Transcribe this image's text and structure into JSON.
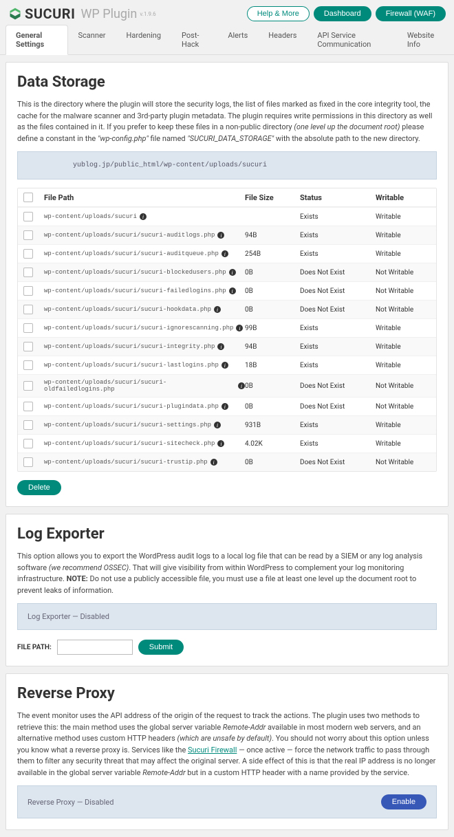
{
  "brand": {
    "text": "SUCURI",
    "plugin": "WP Plugin",
    "version": "v.1.9.6"
  },
  "topButtons": {
    "help": "Help & More",
    "dashboard": "Dashboard",
    "firewall": "Firewall (WAF)"
  },
  "tabs": [
    "General Settings",
    "Scanner",
    "Hardening",
    "Post-Hack",
    "Alerts",
    "Headers",
    "API Service Communication",
    "Website Info"
  ],
  "activeTab": 0,
  "dataStorage": {
    "title": "Data Storage",
    "desc_a": "This is the directory where the plugin will store the security logs, the list of files marked as fixed in the core integrity tool, the cache for the malware scanner and 3rd-party plugin metadata. The plugin requires write permissions in this directory as well as the files contained in it. If you prefer to keep these files in a non-public directory ",
    "desc_b": "(one level up the document root)",
    "desc_c": " please define a constant in the ",
    "desc_d": "\"wp-config.php\"",
    "desc_e": " file named ",
    "desc_f": "\"SUCURI_DATA_STORAGE\"",
    "desc_g": " with the absolute path to the new directory.",
    "path": "yublog.jp/public_html/wp-content/uploads/sucuri",
    "headers": {
      "file": "File Path",
      "size": "File Size",
      "status": "Status",
      "writable": "Writable"
    },
    "rows": [
      {
        "file": "wp-content/uploads/sucuri",
        "size": "",
        "status": "Exists",
        "writable": "Writable"
      },
      {
        "file": "wp-content/uploads/sucuri/sucuri-auditlogs.php",
        "size": "94B",
        "status": "Exists",
        "writable": "Writable"
      },
      {
        "file": "wp-content/uploads/sucuri/sucuri-auditqueue.php",
        "size": "254B",
        "status": "Exists",
        "writable": "Writable"
      },
      {
        "file": "wp-content/uploads/sucuri/sucuri-blockedusers.php",
        "size": "0B",
        "status": "Does Not Exist",
        "writable": "Not Writable"
      },
      {
        "file": "wp-content/uploads/sucuri/sucuri-failedlogins.php",
        "size": "0B",
        "status": "Does Not Exist",
        "writable": "Not Writable"
      },
      {
        "file": "wp-content/uploads/sucuri/sucuri-hookdata.php",
        "size": "0B",
        "status": "Does Not Exist",
        "writable": "Not Writable"
      },
      {
        "file": "wp-content/uploads/sucuri/sucuri-ignorescanning.php",
        "size": "99B",
        "status": "Exists",
        "writable": "Writable"
      },
      {
        "file": "wp-content/uploads/sucuri/sucuri-integrity.php",
        "size": "94B",
        "status": "Exists",
        "writable": "Writable"
      },
      {
        "file": "wp-content/uploads/sucuri/sucuri-lastlogins.php",
        "size": "18B",
        "status": "Exists",
        "writable": "Writable"
      },
      {
        "file": "wp-content/uploads/sucuri/sucuri-oldfailedlogins.php",
        "size": "0B",
        "status": "Does Not Exist",
        "writable": "Not Writable"
      },
      {
        "file": "wp-content/uploads/sucuri/sucuri-plugindata.php",
        "size": "0B",
        "status": "Does Not Exist",
        "writable": "Not Writable"
      },
      {
        "file": "wp-content/uploads/sucuri/sucuri-settings.php",
        "size": "931B",
        "status": "Exists",
        "writable": "Writable"
      },
      {
        "file": "wp-content/uploads/sucuri/sucuri-sitecheck.php",
        "size": "4.02K",
        "status": "Exists",
        "writable": "Writable"
      },
      {
        "file": "wp-content/uploads/sucuri/sucuri-trustip.php",
        "size": "0B",
        "status": "Does Not Exist",
        "writable": "Not Writable"
      }
    ],
    "deleteBtn": "Delete"
  },
  "logExporter": {
    "title": "Log Exporter",
    "desc_a": "This option allows you to export the WordPress audit logs to a local log file that can be read by a SIEM or any log analysis software ",
    "desc_b": "(we recommend OSSEC)",
    "desc_c": ". That will give visibility from within WordPress to complement your log monitoring infrastructure. ",
    "desc_d": "NOTE:",
    "desc_e": " Do not use a publicly accessible file, you must use a file at least one level up the document root to prevent leaks of information.",
    "status": "Log Exporter — Disabled",
    "label": "FILE PATH:",
    "submit": "Submit"
  },
  "reverseProxy": {
    "title": "Reverse Proxy",
    "desc_a": "The event monitor uses the API address of the origin of the request to track the actions. The plugin uses two methods to retrieve this: the main method uses the global server variable ",
    "desc_b": "Remote-Addr",
    "desc_c": " available in most modern web servers, and an alternative method uses custom HTTP headers ",
    "desc_d": "(which are unsafe by default)",
    "desc_e": ". You should not worry about this option unless you know what a reverse proxy is. Services like the ",
    "desc_link": "Sucuri Firewall",
    "desc_f": " — once active — force the network traffic to pass through them to filter any security threat that may affect the original server. A side effect of this is that the real IP address is no longer available in the global server variable ",
    "desc_g": "Remote-Addr",
    "desc_h": " but in a custom HTTP header with a name provided by the service.",
    "status": "Reverse Proxy — Disabled",
    "enable": "Enable"
  }
}
